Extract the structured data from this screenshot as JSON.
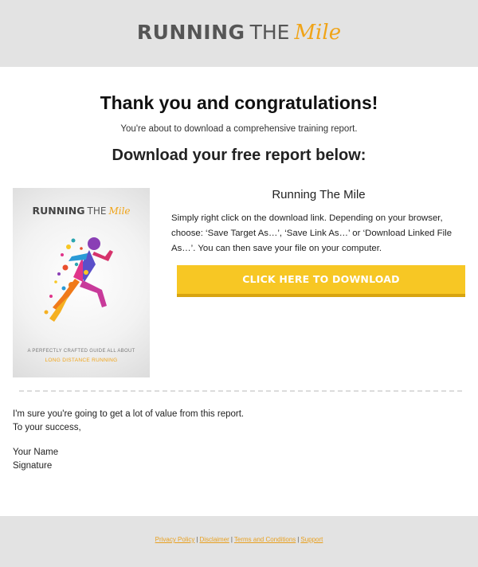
{
  "header": {
    "logo_word1": "RUNNING",
    "logo_word2": "THE",
    "logo_word3": "Mile"
  },
  "main": {
    "heading": "Thank you and congratulations!",
    "subheading": "You're about to download a comprehensive training report.",
    "section_heading": "Download your free report below:"
  },
  "cover": {
    "title_word1": "RUNNING",
    "title_word2": "THE",
    "title_word3": "Mile",
    "tagline": "A PERFECTLY CRAFTED GUIDE ALL ABOUT",
    "subtitle": "LONG DISTANCE RUNNING"
  },
  "product": {
    "title": "Running The Mile",
    "instructions": "Simply right click on the download link. Depending on your browser, choose: ‘Save Target As…’, ‘Save Link As…’ or ‘Download Linked File As…’. You can then save your file on your computer.",
    "button_label": "CLICK HERE TO DOWNLOAD"
  },
  "closing": {
    "line1": "I'm sure you're going to get a lot of value from this report.",
    "line2": "To your success,",
    "name": "Your Name",
    "signature": "Signature"
  },
  "footer": {
    "links": [
      "Privacy Policy",
      "Disclaimer",
      "Terms and Conditions",
      "Support"
    ],
    "separator": "|"
  },
  "colors": {
    "accent": "#f0a418",
    "button": "#f7c724",
    "band": "#e3e3e3"
  }
}
